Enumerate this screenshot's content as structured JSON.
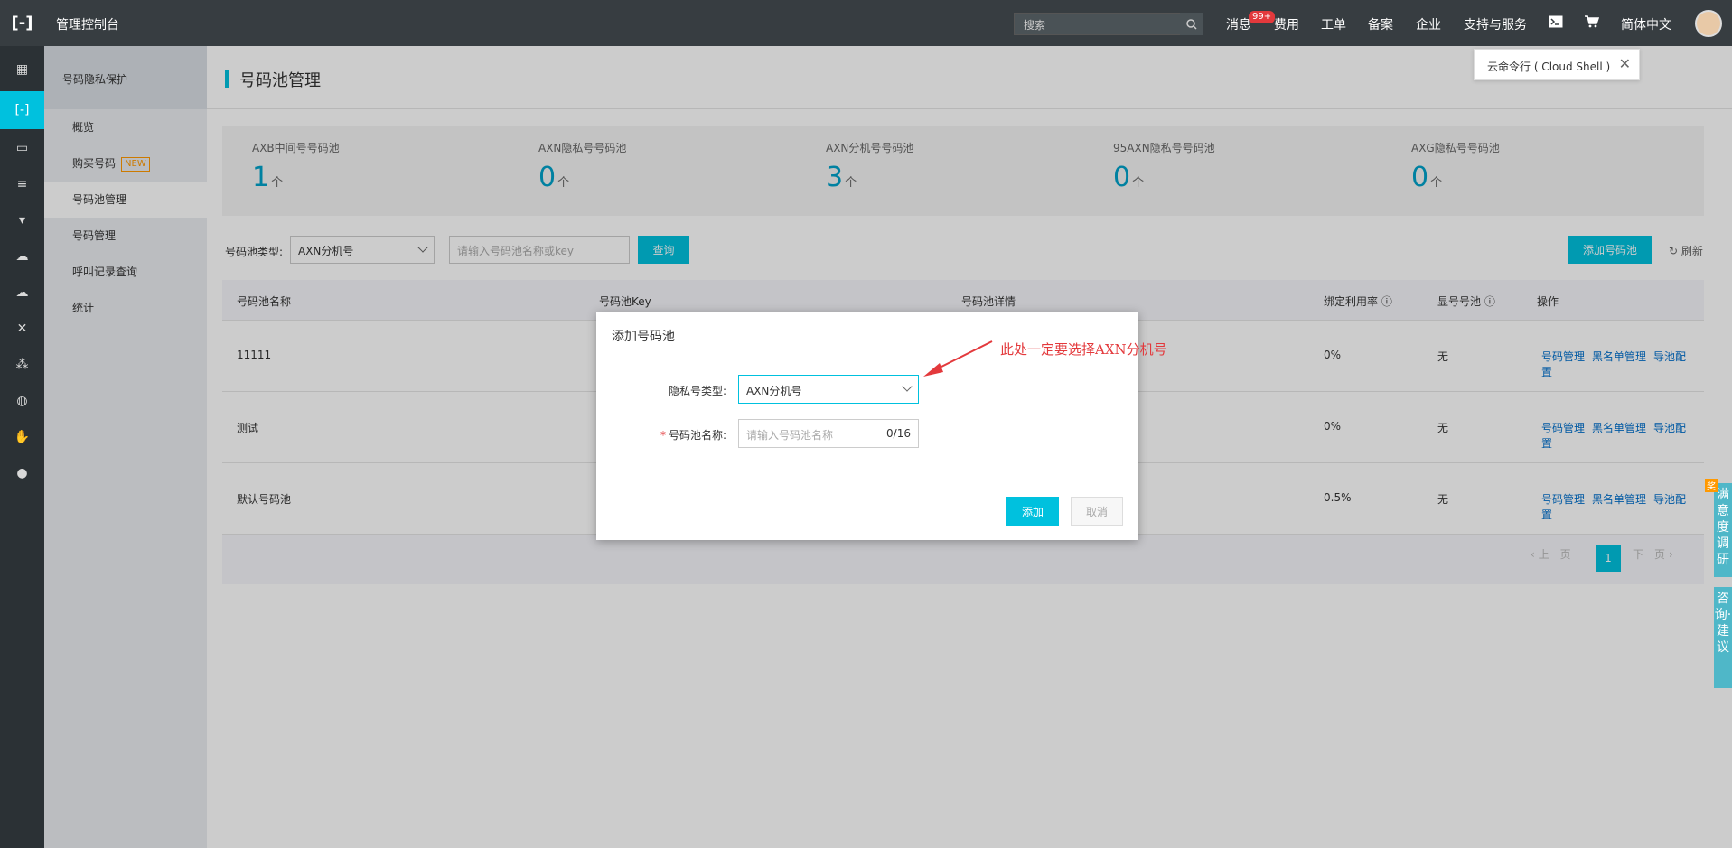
{
  "topbar": {
    "logo": "[-]",
    "title": "管理控制台",
    "search_placeholder": "搜索",
    "nav": {
      "messages": "消息",
      "messages_badge": "99+",
      "fees": "费用",
      "tickets": "工单",
      "filing": "备案",
      "enterprise": "企业",
      "support": "支持与服务",
      "lang": "简体中文"
    }
  },
  "tooltip": {
    "text": "云命令行 ( Cloud Shell )"
  },
  "subsidebar": {
    "title": "号码隐私保护",
    "items": [
      {
        "label": "概览"
      },
      {
        "label": "购买号码",
        "tag": "NEW"
      },
      {
        "label": "号码池管理"
      },
      {
        "label": "号码管理"
      },
      {
        "label": "呼叫记录查询"
      },
      {
        "label": "统计"
      }
    ]
  },
  "page": {
    "title": "号码池管理",
    "stats": [
      {
        "label": "AXB中间号号码池",
        "value": "1",
        "unit": "个"
      },
      {
        "label": "AXN隐私号号码池",
        "value": "0",
        "unit": "个"
      },
      {
        "label": "AXN分机号号码池",
        "value": "3",
        "unit": "个"
      },
      {
        "label": "95AXN隐私号号码池",
        "value": "0",
        "unit": "个"
      },
      {
        "label": "AXG隐私号号码池",
        "value": "0",
        "unit": "个"
      }
    ],
    "filter": {
      "type_label": "号码池类型:",
      "type_value": "AXN分机号",
      "search_placeholder": "请输入号码池名称或key",
      "query_button": "查询",
      "add_button": "添加号码池",
      "refresh": "刷新"
    },
    "table": {
      "headers": [
        "号码池名称",
        "号码池Key",
        "号码池详情",
        "绑定利用率",
        "显号号池",
        "操作"
      ],
      "rows": [
        {
          "name": "11111",
          "rate": "0%",
          "display": "无"
        },
        {
          "name": "测试",
          "rate": "0%",
          "display": "无"
        },
        {
          "name": "默认号码池",
          "rate": "0.5%",
          "display": "无"
        }
      ],
      "actions": [
        "号码管理",
        "黑名单管理",
        "导池配置"
      ],
      "pager": {
        "prev": "上一页",
        "current": "1",
        "next": "下一页"
      }
    }
  },
  "modal": {
    "title": "添加号码池",
    "type_label": "隐私号类型:",
    "type_value": "AXN分机号",
    "name_label": "号码池名称:",
    "name_placeholder": "请输入号码池名称",
    "name_count": "0/16",
    "add_button": "添加",
    "cancel_button": "取消"
  },
  "annotation": {
    "text": "此处一定要选择AXN分机号",
    "color": "#e3393c"
  },
  "floating": {
    "survey": "满意度调研",
    "survey_badge": "奖",
    "consult": "咨询·建议"
  },
  "colors": {
    "accent": "#00c1de",
    "topbar": "#373d41",
    "link": "#0070cc"
  }
}
